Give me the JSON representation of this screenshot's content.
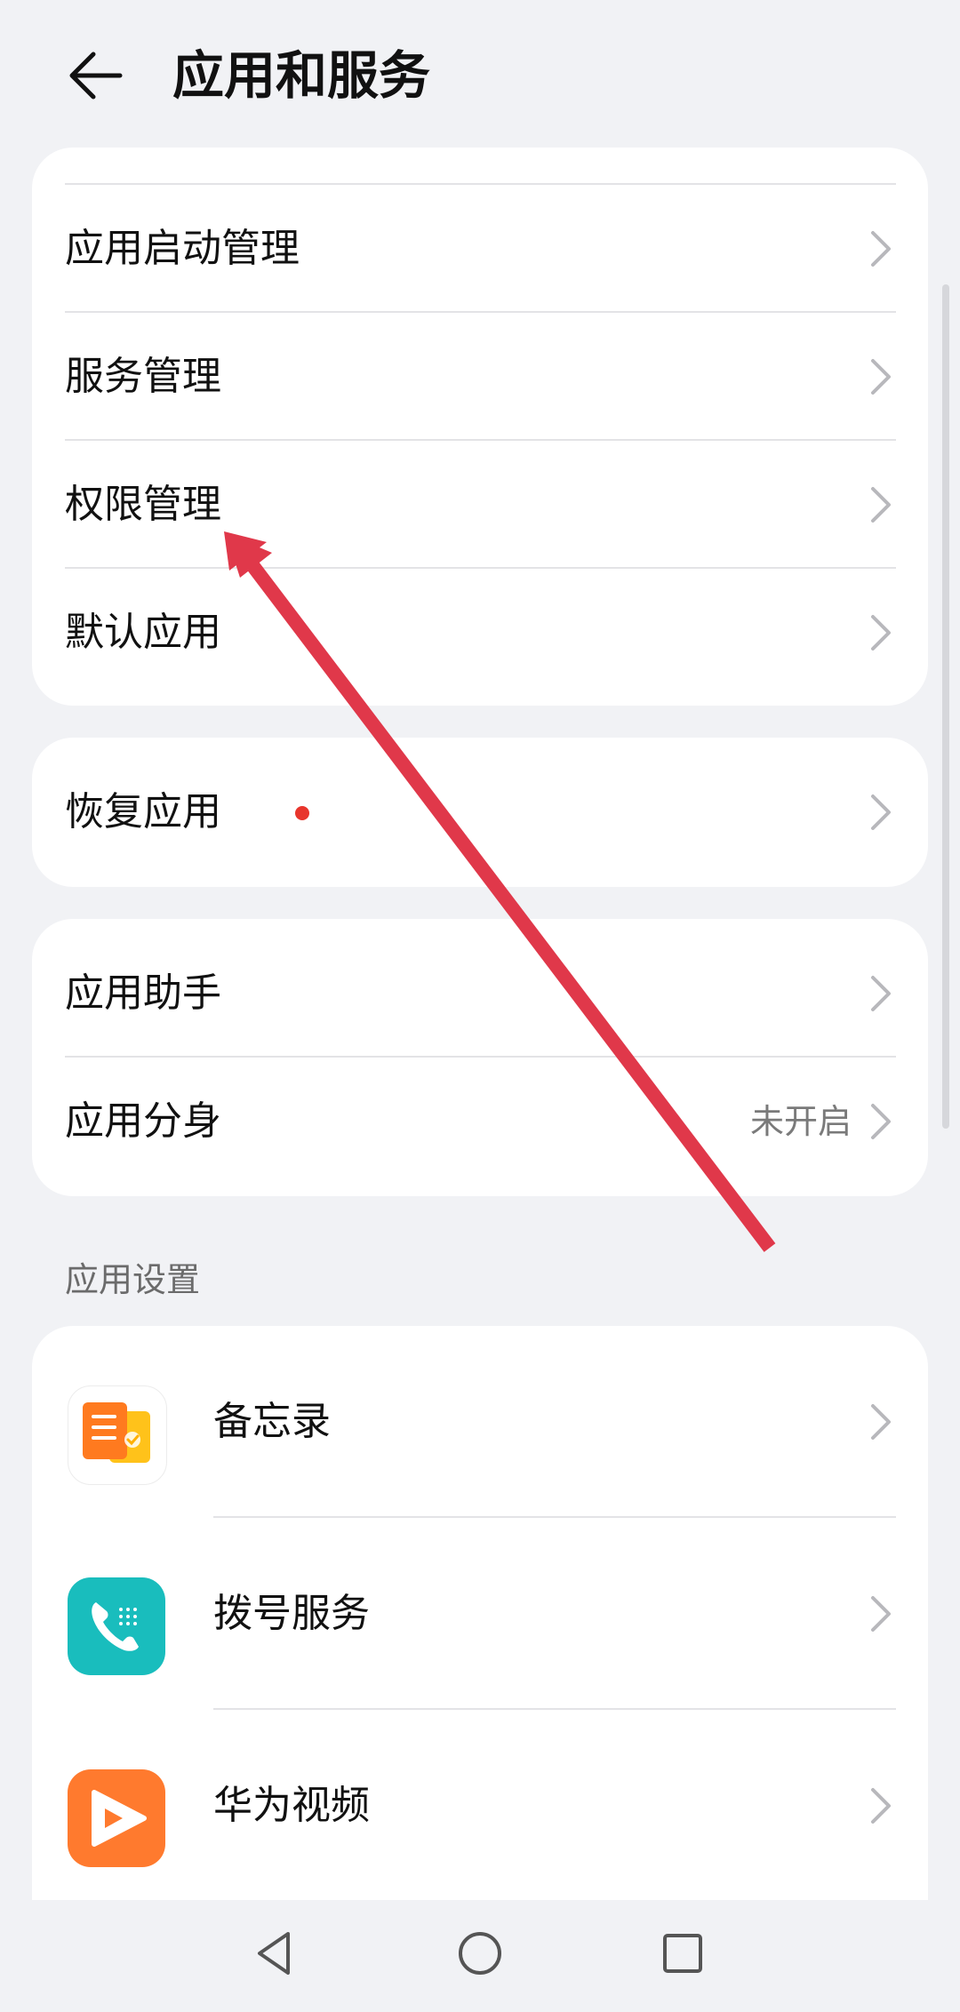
{
  "header": {
    "title": "应用和服务"
  },
  "group1": {
    "items": [
      {
        "label": "应用启动管理"
      },
      {
        "label": "服务管理"
      },
      {
        "label": "权限管理"
      },
      {
        "label": "默认应用"
      }
    ]
  },
  "group2": {
    "items": [
      {
        "label": "恢复应用",
        "badge": "red-dot"
      }
    ]
  },
  "group3": {
    "items": [
      {
        "label": "应用助手"
      },
      {
        "label": "应用分身",
        "value": "未开启"
      }
    ]
  },
  "app_settings": {
    "header": "应用设置",
    "apps": [
      {
        "label": "备忘录",
        "icon": "notepad-icon"
      },
      {
        "label": "拨号服务",
        "icon": "phone-icon"
      },
      {
        "label": "华为视频",
        "icon": "video-icon"
      }
    ]
  },
  "nav": {
    "back": "back-triangle-icon",
    "home": "home-circle-icon",
    "recents": "recents-square-icon"
  },
  "colors": {
    "background": "#f1f2f5",
    "card": "#ffffff",
    "badge": "#e8352c",
    "annotation_arrow": "#e0384a",
    "phone_icon": "#1abfbf",
    "video_icon": "#ff7a2e",
    "notepad_icon": "#ff7a1f"
  }
}
